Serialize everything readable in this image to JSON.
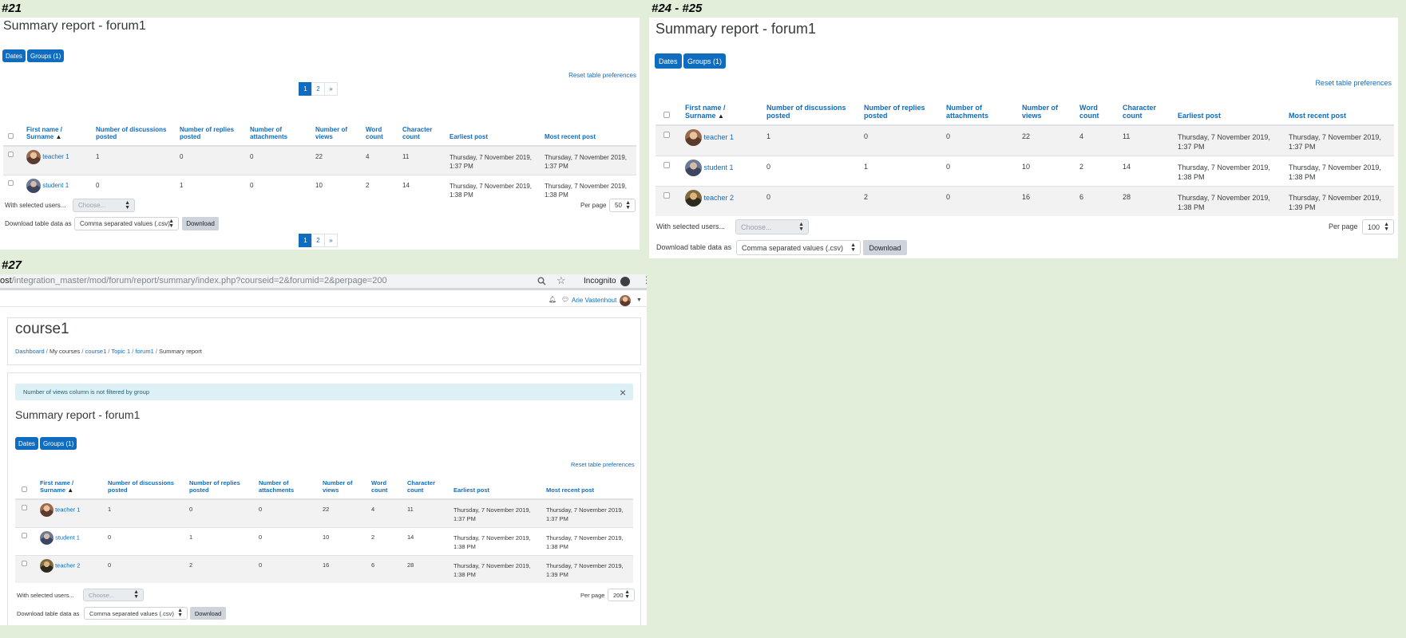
{
  "labels": {
    "p21": "#21",
    "p24": "#24 - #25",
    "p27": "#27"
  },
  "report": {
    "title": "Summary report - forum1",
    "dates_btn": "Dates",
    "groups_btn": "Groups (1)",
    "reset": "Reset table preferences",
    "with_selected": "With selected users...",
    "choose": "Choose...",
    "per_page_label": "Per page",
    "download_label": "Download table data as",
    "download_format": "Comma separated values (.csv)",
    "download_btn": "Download"
  },
  "pager": {
    "p1": "1",
    "p2": "2",
    "next": "»"
  },
  "columns": {
    "name1": "First name /",
    "name2": "Surname",
    "disc": "Number of discussions posted",
    "replies": "Number of replies posted",
    "attach": "Number of attachments",
    "views": "Number of views",
    "words": "Word count",
    "chars": "Character count",
    "earliest": "Earliest post",
    "recent": "Most recent post"
  },
  "rows": [
    {
      "name": "teacher 1",
      "disc": "1",
      "replies": "0",
      "attach": "0",
      "views": "22",
      "words": "4",
      "chars": "11",
      "earliest": "Thursday, 7 November 2019, 1:37 PM",
      "recent": "Thursday, 7 November 2019, 1:37 PM"
    },
    {
      "name": "student 1",
      "disc": "0",
      "replies": "1",
      "attach": "0",
      "views": "10",
      "words": "2",
      "chars": "14",
      "earliest": "Thursday, 7 November 2019, 1:38 PM",
      "recent": "Thursday, 7 November 2019, 1:38 PM"
    },
    {
      "name": "teacher 2",
      "disc": "0",
      "replies": "2",
      "attach": "0",
      "views": "16",
      "words": "6",
      "chars": "28",
      "earliest": "Thursday, 7 November 2019, 1:38 PM",
      "recent": "Thursday, 7 November 2019, 1:39 PM"
    }
  ],
  "panel21": {
    "per_page": "50"
  },
  "panel24": {
    "per_page": "100"
  },
  "panel27": {
    "url_prefix": "ost",
    "url_rest": "/integration_master/mod/forum/report/summary/index.php?courseid=2&forumid=2&perpage=200",
    "incognito": "Incognito",
    "user": "Arie Vastenhout",
    "course": "course1",
    "crumbs": {
      "dashboard": "Dashboard",
      "mycourses": "My courses",
      "course": "course1",
      "topic": "Topic 1",
      "forum": "forum1",
      "current": "Summary report"
    },
    "notice": "Number of views column is not filtered by group",
    "per_page": "200"
  },
  "colors": {
    "primary": "#0f6cbf",
    "background": "#e2eed9",
    "notice_bg": "#dcf0f6"
  }
}
